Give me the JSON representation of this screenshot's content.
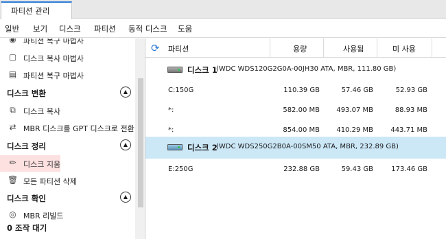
{
  "tabs": [
    {
      "label": "파티션 관리"
    }
  ],
  "menu": [
    "일반",
    "보기",
    "디스크",
    "파티션",
    "동적 디스크",
    "도움"
  ],
  "sidebar": {
    "items": [
      {
        "type": "item",
        "label": "파티션 복구 마법사",
        "icon": "partition-recovery-icon"
      },
      {
        "type": "item",
        "label": "디스크 복사 마법사",
        "icon": "disk-copy-wizard-icon"
      },
      {
        "type": "item",
        "label": "파티션 복구 마법사",
        "icon": "partition-recovery-icon"
      },
      {
        "type": "section",
        "label": "디스크 변환"
      },
      {
        "type": "item",
        "label": "디스크 복사",
        "icon": "disk-copy-icon"
      },
      {
        "type": "item",
        "label": "MBR 디스크를 GPT 디스크로 전환",
        "icon": "convert-icon"
      },
      {
        "type": "section",
        "label": "디스크 정리"
      },
      {
        "type": "item",
        "label": "디스크 지움",
        "icon": "eraser-icon",
        "selected": true
      },
      {
        "type": "item",
        "label": "모든 파티션 삭제",
        "icon": "trash-icon"
      },
      {
        "type": "section",
        "label": "디스크 확인"
      },
      {
        "type": "item",
        "label": "MBR 리빌드",
        "icon": "rebuild-mbr-icon"
      }
    ],
    "status": "0 조작 대기"
  },
  "table": {
    "columns": [
      "파티션",
      "용량",
      "사용됨",
      "미 사용"
    ],
    "disks": [
      {
        "name": "디스크 1",
        "info": "(WDC WDS120G2G0A-00JH30 ATA, MBR, 111.80 GB)",
        "selected": false,
        "partitions": [
          {
            "name": "C:150G",
            "capacity": "110.39 GB",
            "used": "57.46 GB",
            "free": "52.93 GB"
          },
          {
            "name": "*:",
            "capacity": "582.00 MB",
            "used": "493.07 MB",
            "free": "88.93 MB"
          },
          {
            "name": "*:",
            "capacity": "854.00 MB",
            "used": "410.29 MB",
            "free": "443.71 MB"
          }
        ]
      },
      {
        "name": "디스크 2",
        "info": "(WDC WDS250G2B0A-00SM50 ATA, MBR, 232.89 GB)",
        "selected": true,
        "partitions": [
          {
            "name": "E:250G",
            "capacity": "232.88 GB",
            "used": "59.43 GB",
            "free": "173.46 GB"
          }
        ]
      }
    ]
  },
  "colors": {
    "accent": "#2d7bd4",
    "selected_row": "#cce8f7",
    "selected_sidebar": "#fde0e0"
  }
}
